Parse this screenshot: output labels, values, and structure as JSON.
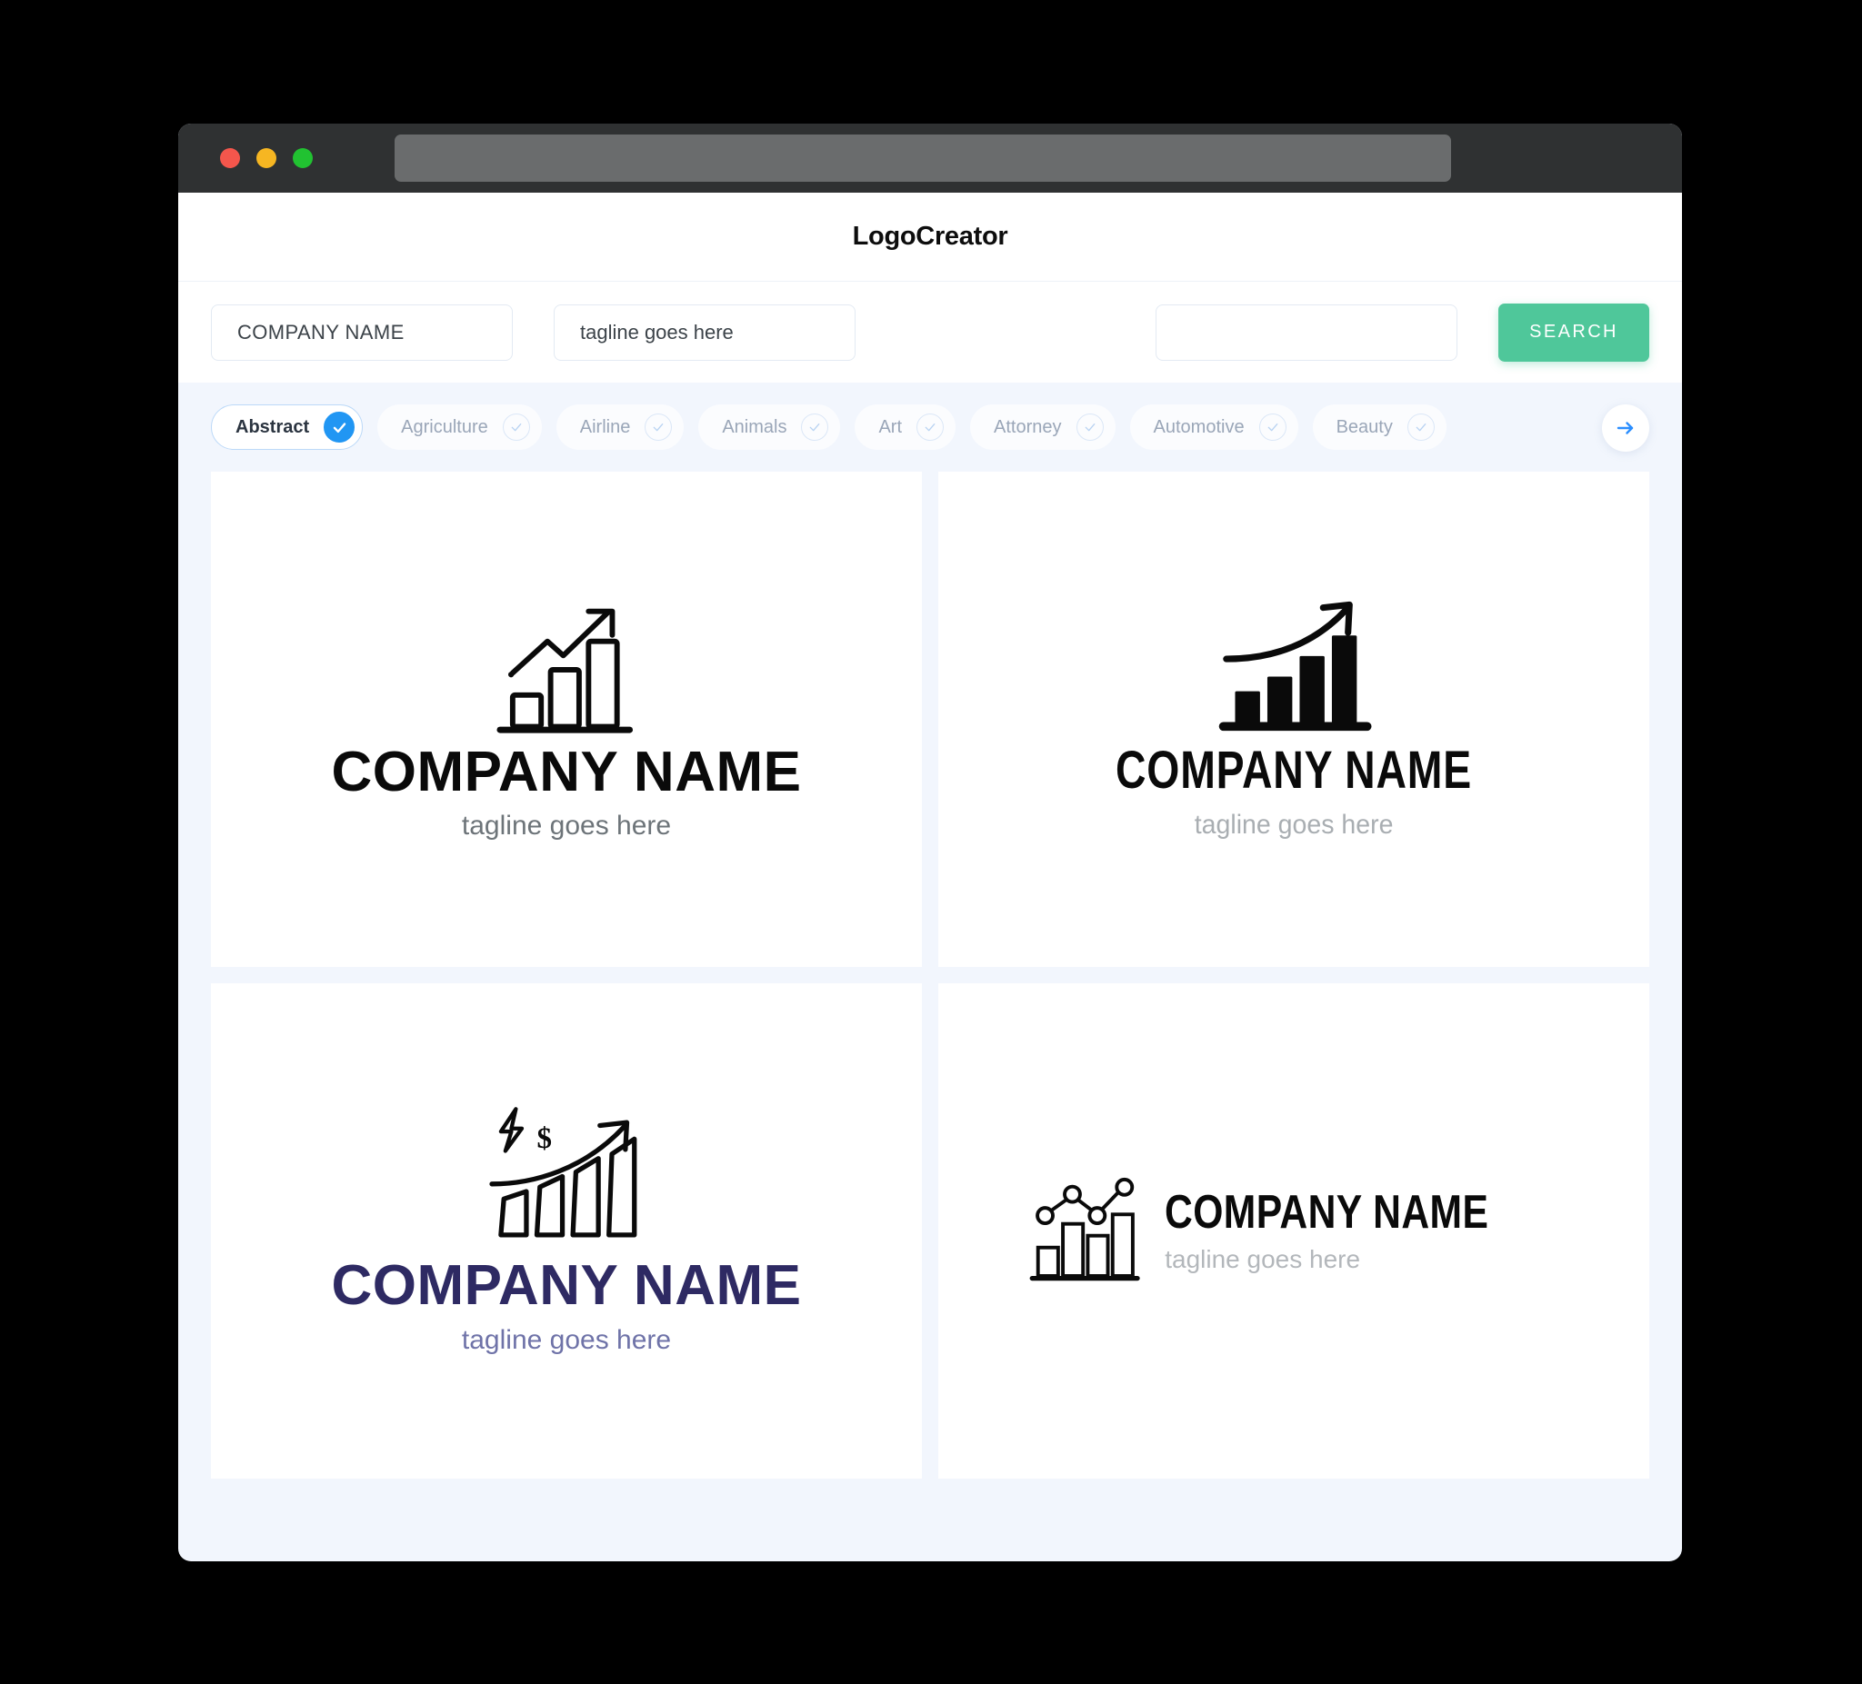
{
  "window": {
    "traffic_lights": [
      {
        "name": "close",
        "color": "#f4564c"
      },
      {
        "name": "minimize",
        "color": "#f6b622"
      },
      {
        "name": "maximize",
        "color": "#21c231"
      }
    ],
    "url_value": ""
  },
  "header": {
    "title": "LogoCreator"
  },
  "search": {
    "company_value": "COMPANY NAME",
    "company_placeholder": "COMPANY NAME",
    "tagline_value": "tagline goes here",
    "tagline_placeholder": "tagline goes here",
    "extra_value": "",
    "extra_placeholder": "",
    "button_label": "SEARCH",
    "button_color": "#4fc79a"
  },
  "categories": {
    "accent_color": "#2196f3",
    "next_label": "next-page",
    "items": [
      {
        "label": "Abstract",
        "selected": true
      },
      {
        "label": "Agriculture",
        "selected": false
      },
      {
        "label": "Airline",
        "selected": false
      },
      {
        "label": "Animals",
        "selected": false
      },
      {
        "label": "Art",
        "selected": false
      },
      {
        "label": "Attorney",
        "selected": false
      },
      {
        "label": "Automotive",
        "selected": false
      },
      {
        "label": "Beauty",
        "selected": false
      }
    ]
  },
  "results": {
    "cards": [
      {
        "id": "logo-1",
        "layout": "stacked",
        "icon": "outline-bar-chart-zigzag-arrow-icon",
        "name": "COMPANY NAME",
        "tagline": "tagline goes here",
        "name_color": "#0a0a0a",
        "tagline_color": "#6d7479"
      },
      {
        "id": "logo-2",
        "layout": "stacked",
        "icon": "solid-bar-chart-curved-arrow-icon",
        "name": "COMPANY NAME",
        "tagline": "tagline goes here",
        "name_color": "#0a0a0a",
        "tagline_color": "#a9aeb2"
      },
      {
        "id": "logo-3",
        "layout": "stacked",
        "icon": "outline-bar-chart-bolt-dollar-arrow-icon",
        "name": "COMPANY NAME",
        "tagline": "tagline goes here",
        "name_color": "#2e2a63",
        "tagline_color": "#6f73a8"
      },
      {
        "id": "logo-4",
        "layout": "horizontal",
        "icon": "outline-bar-chart-dot-line-icon",
        "name": "COMPANY NAME",
        "tagline": "tagline goes here",
        "name_color": "#0a0a0a",
        "tagline_color": "#b3b7bb"
      }
    ]
  }
}
